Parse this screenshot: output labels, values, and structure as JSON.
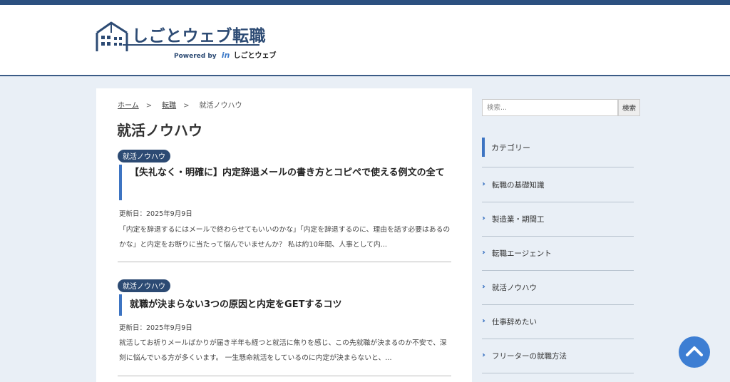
{
  "header": {
    "logo_text": "しごとウェブ転職",
    "powered_by": "Powered by",
    "brand_icon": "in",
    "brand_name": "しごとウェブ"
  },
  "breadcrumb": [
    {
      "label": "ホーム"
    },
    {
      "label": "転職"
    },
    {
      "label": "就活ノウハウ"
    }
  ],
  "page_title": "就活ノウハウ",
  "posts": [
    {
      "category": "就活ノウハウ",
      "title": "【失礼なく・明確に】内定辞退メールの書き方とコピペで使える例文の全て",
      "date": "更新日：2025年9月9日",
      "excerpt": "「内定を辞退するにはメールで終わらせてもいいのかな」「内定を辞退するのに、理由を話す必要はあるのかな」と内定をお断りに当たって悩んでいませんか？ 私は約10年間、人事として内..."
    },
    {
      "category": "就活ノウハウ",
      "title": "就職が決まらない3つの原因と内定をGETするコツ",
      "date": "更新日：2025年9月9日",
      "excerpt": "就活してお祈りメールばかりが届き半年も経つと就活に焦りを感じ、この先就職が決まるのか不安で、深刻に悩んでいる方が多くいます。 一生懸命就活をしているのに内定が決まらないと、..."
    }
  ],
  "sidebar": {
    "search_placeholder": "検索...",
    "search_button": "検索",
    "category_heading": "カテゴリー",
    "categories": [
      "転職の基礎知識",
      "製造業・期間工",
      "転職エージェント",
      "就活ノウハウ",
      "仕事辞めたい",
      "フリーターの就職方法"
    ]
  },
  "icons": {
    "logo": "building-icon",
    "chevron": "double-chevron-right-icon",
    "scroll_top": "chevron-up-icon"
  },
  "colors": {
    "accent": "#3d74c2",
    "brand_navy": "#2c4a73",
    "background": "#e9eff6"
  }
}
